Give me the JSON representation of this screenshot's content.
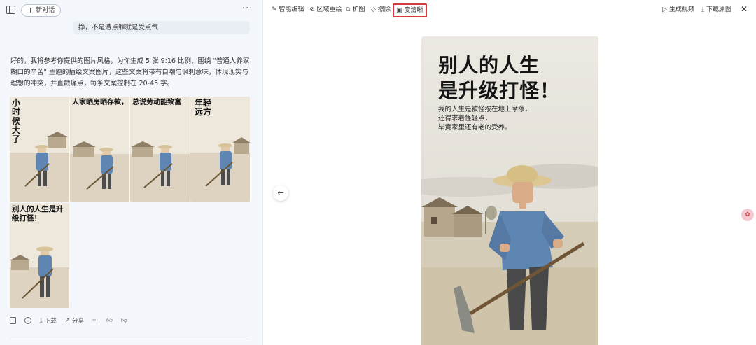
{
  "chat": {
    "new_chat_label": "新对话",
    "more_label": "···",
    "user_message": "挣，不是遭点罪就是受点气",
    "ai_message": "好的，我将参考你提供的图片风格，为你生成 5 张 9:16 比例、围绕 \"普通人养家糊口的辛苦\" 主题的插绘文案图片，这些文案将带有自嘲与讽刺意味，体现现实与理想的冲突，并直戳痛点，每条文案控制在 20-45 字。",
    "thumbnails": [
      {
        "caption": "小时候大了"
      },
      {
        "caption": "人家晒房晒存款，"
      },
      {
        "caption": "总说劳动能致富"
      },
      {
        "caption": "年轻远方"
      },
      {
        "caption": "别人的人生是升级打怪！"
      }
    ],
    "actions": {
      "download_label": "下载",
      "share_label": "分享",
      "more_label": "···"
    }
  },
  "viewer": {
    "toolbar": {
      "smart_edit": "智能编辑",
      "region_redraw": "区域重绘",
      "expand": "扩图",
      "erase": "擦除",
      "sharpen": "变清晰",
      "gen_video": "生成视频",
      "download_original": "下载原图",
      "close": "✕"
    },
    "prev_icon": "←",
    "image": {
      "title_line1": "别人的人生",
      "title_line2": "是升级打怪！",
      "sub_line1": "我的人生是被怪按在地上摩擦，",
      "sub_line2": "还得求着怪轻点，",
      "sub_line3": "毕竟家里还有老的受养。"
    }
  },
  "colors": {
    "highlight": "#d9363e",
    "left_bg": "#f4f7fc"
  }
}
